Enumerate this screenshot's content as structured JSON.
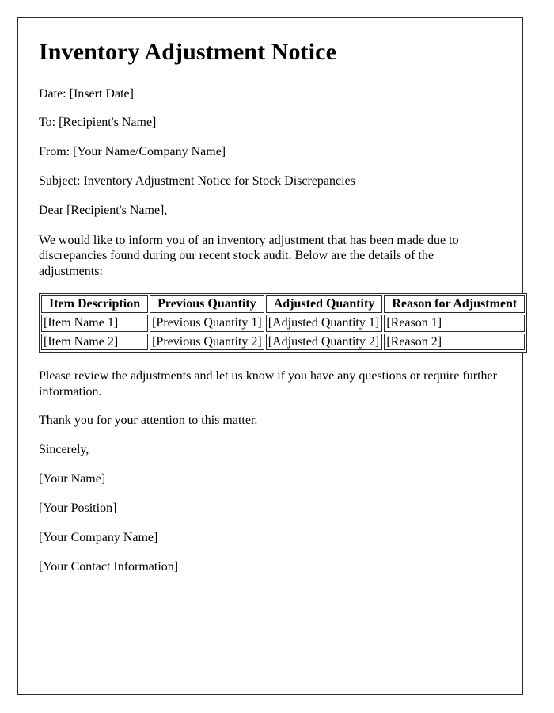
{
  "document": {
    "title": "Inventory Adjustment Notice",
    "header_fields": [
      "Date: [Insert Date]",
      "To: [Recipient's Name]",
      "From: [Your Name/Company Name]",
      "Subject: Inventory Adjustment Notice for Stock Discrepancies"
    ],
    "salutation": "Dear [Recipient's Name],",
    "intro_paragraph": "We would like to inform you of an inventory adjustment that has been made due to discrepancies found during our recent stock audit. Below are the details of the adjustments:",
    "table": {
      "columns": [
        "Item Description",
        "Previous Quantity",
        "Adjusted Quantity",
        "Reason for Adjustment"
      ],
      "rows": [
        [
          "[Item Name 1]",
          "[Previous Quantity 1]",
          "[Adjusted Quantity 1]",
          "[Reason 1]"
        ],
        [
          "[Item Name 2]",
          "[Previous Quantity 2]",
          "[Adjusted Quantity 2]",
          "[Reason 2]"
        ]
      ]
    },
    "closing_paragraphs": [
      "Please review the adjustments and let us know if you have any questions or require further information.",
      "Thank you for your attention to this matter."
    ],
    "sign_off": "Sincerely,",
    "signature_lines": [
      "[Your Name]",
      "[Your Position]",
      "[Your Company Name]",
      "[Your Contact Information]"
    ]
  },
  "colors": {
    "page_background": "#ffffff",
    "page_border": "#2b2b2b",
    "text": "#000000",
    "table_border": "#2b2b2b"
  }
}
